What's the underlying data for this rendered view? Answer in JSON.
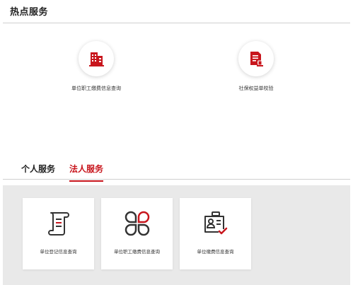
{
  "hot_services": {
    "title": "热点服务",
    "items": [
      {
        "label": "单位职工缴费信息查询",
        "icon": "building-icon"
      },
      {
        "label": "社保权益单校验",
        "icon": "document-stamp-icon"
      }
    ]
  },
  "tabs": [
    {
      "label": "个人服务",
      "active": false
    },
    {
      "label": "法人服务",
      "active": true
    }
  ],
  "cards": [
    {
      "label": "单位登记信息查询",
      "icon": "scroll-document-icon"
    },
    {
      "label": "单位职工缴费信息查询",
      "icon": "four-petal-icon"
    },
    {
      "label": "单位缴费信息查询",
      "icon": "id-card-check-icon"
    }
  ],
  "colors": {
    "accent": "#c8161d",
    "panel_bg": "#e9e9e9",
    "divider": "#cfcfcf"
  }
}
